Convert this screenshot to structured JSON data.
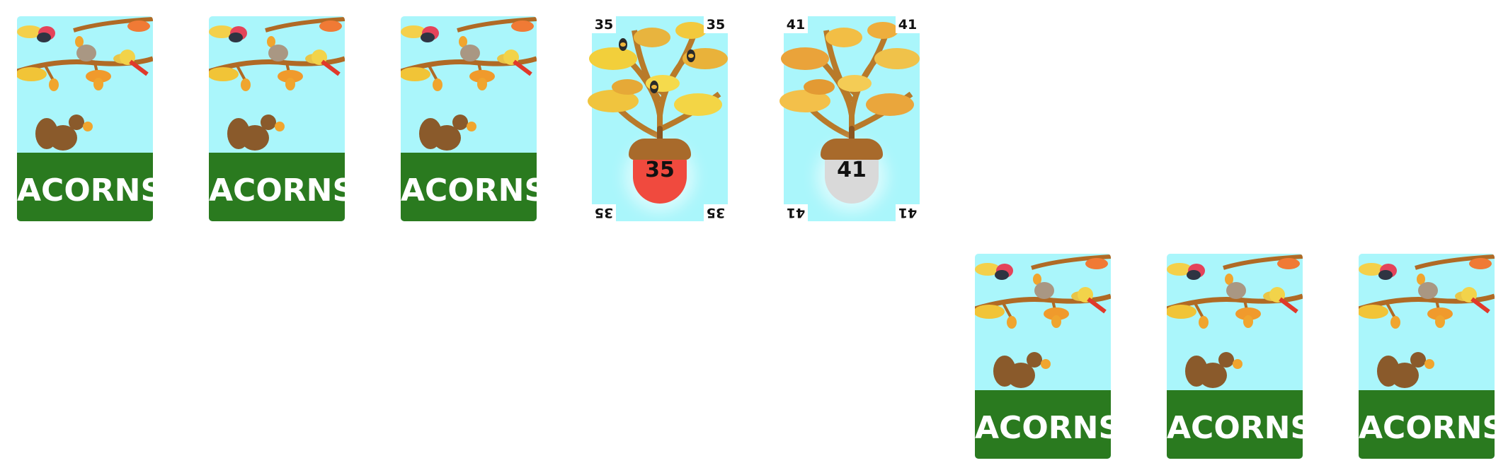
{
  "cards": {
    "back_label": "ACORNS",
    "face_35": {
      "value": "35",
      "corner": "35",
      "acorn_color": "#f04a3e"
    },
    "face_41": {
      "value": "41",
      "corner": "41",
      "acorn_color": "#d9d9d9"
    }
  },
  "icons": [
    "bird-icon",
    "squirrel-icon",
    "acorn-icon",
    "oak-branch-icon",
    "bee-icon"
  ]
}
